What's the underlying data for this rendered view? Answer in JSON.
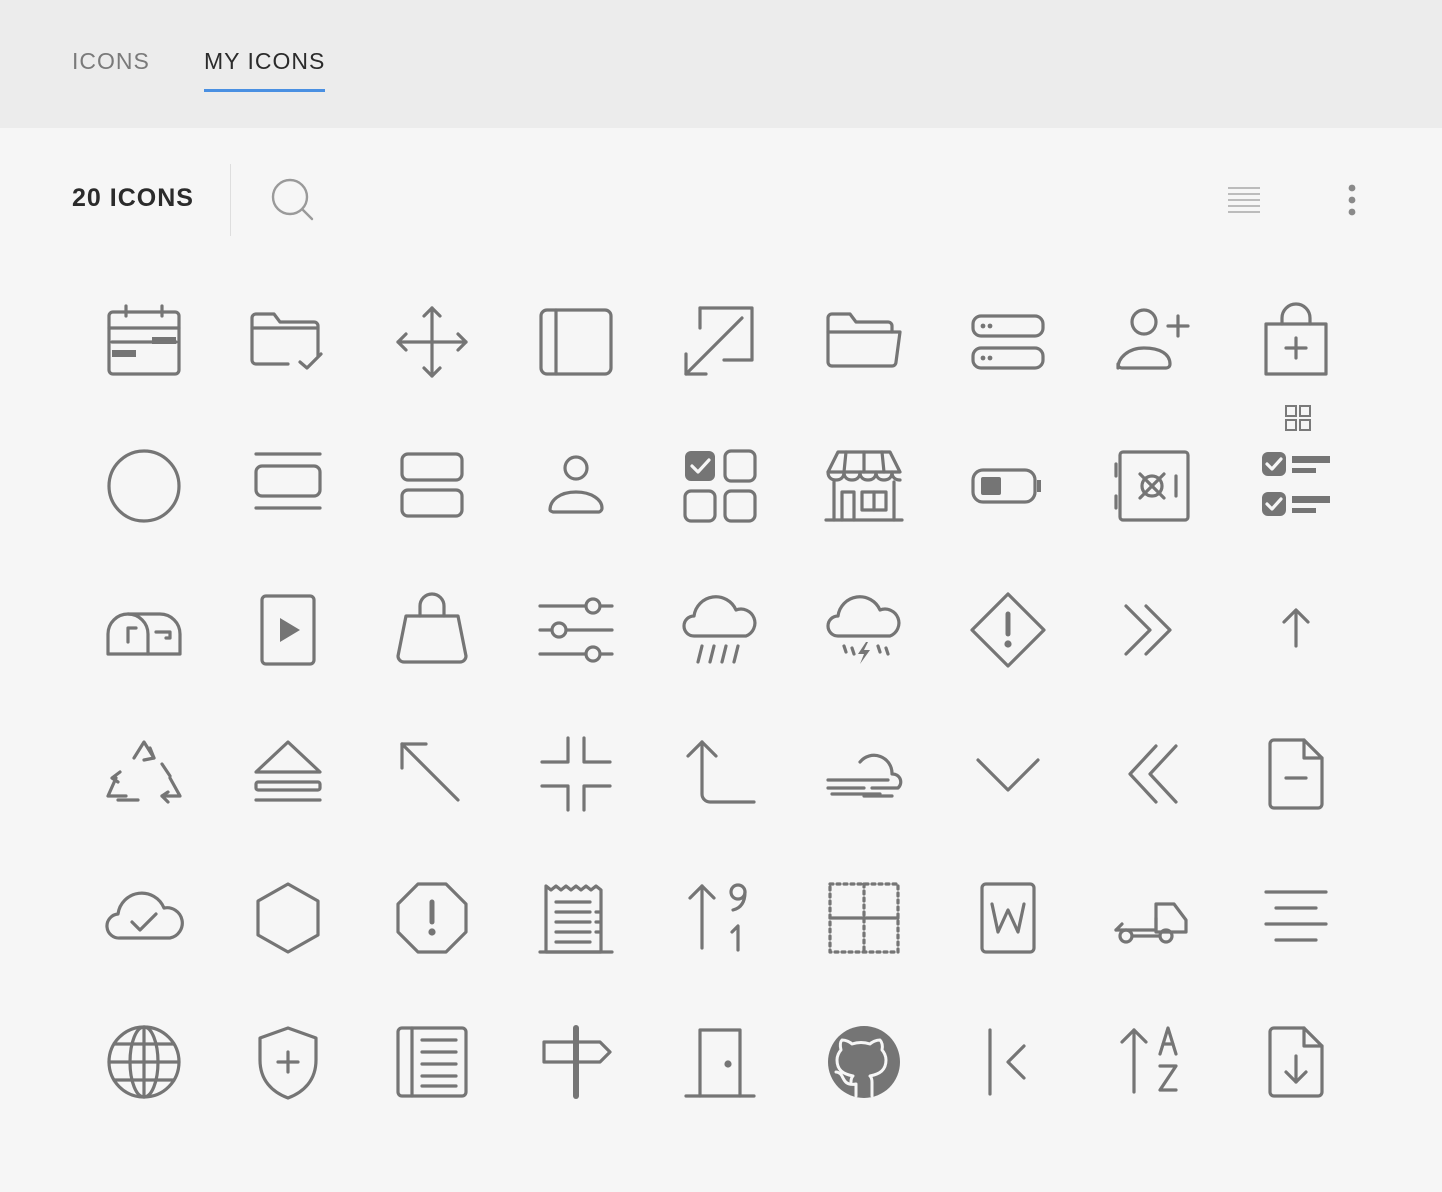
{
  "tabs": {
    "icons": "ICONS",
    "my_icons": "MY ICONS",
    "active": "MY ICONS"
  },
  "toolbar": {
    "count_label": "20 ICONS",
    "search_icon": "search-icon",
    "list_view_icon": "list-view-icon",
    "grid_view_icon": "grid-view-icon",
    "more_icon": "more-vertical-icon"
  },
  "theme": {
    "accent": "#4a90e2",
    "icon_color": "#757575"
  },
  "icons": [
    "calendar-icon",
    "folder-check-icon",
    "move-arrows-icon",
    "sidebar-layout-icon",
    "resize-arrow-icon",
    "folder-open-icon",
    "servers-icon",
    "user-add-icon",
    "shopping-bag-add-icon",
    "circle-icon",
    "carousel-icon",
    "rows-layout-icon",
    "user-icon",
    "grid-checked-icon",
    "storefront-icon",
    "battery-low-icon",
    "safe-icon",
    "checklist-icon",
    "mailbox-icon",
    "video-file-icon",
    "handbag-icon",
    "sliders-icon",
    "rain-cloud-icon",
    "thunderstorm-icon",
    "warning-diamond-icon",
    "chevrons-right-icon",
    "arrow-up-icon",
    "recycle-icon",
    "eject-icon",
    "arrow-up-left-icon",
    "collapse-icon",
    "corner-up-arrow-icon",
    "wind-cloud-icon",
    "chevron-down-icon",
    "chevrons-left-icon",
    "file-minus-icon",
    "cloud-check-icon",
    "hexagon-icon",
    "octagon-alert-icon",
    "receipt-icon",
    "sort-numeric-icon",
    "table-dotted-icon",
    "word-file-icon",
    "tow-truck-icon",
    "align-center-icon",
    "globe-icon",
    "shield-add-icon",
    "notebook-icon",
    "signpost-icon",
    "door-icon",
    "github-icon",
    "first-page-icon",
    "sort-alpha-icon",
    "file-download-icon"
  ]
}
